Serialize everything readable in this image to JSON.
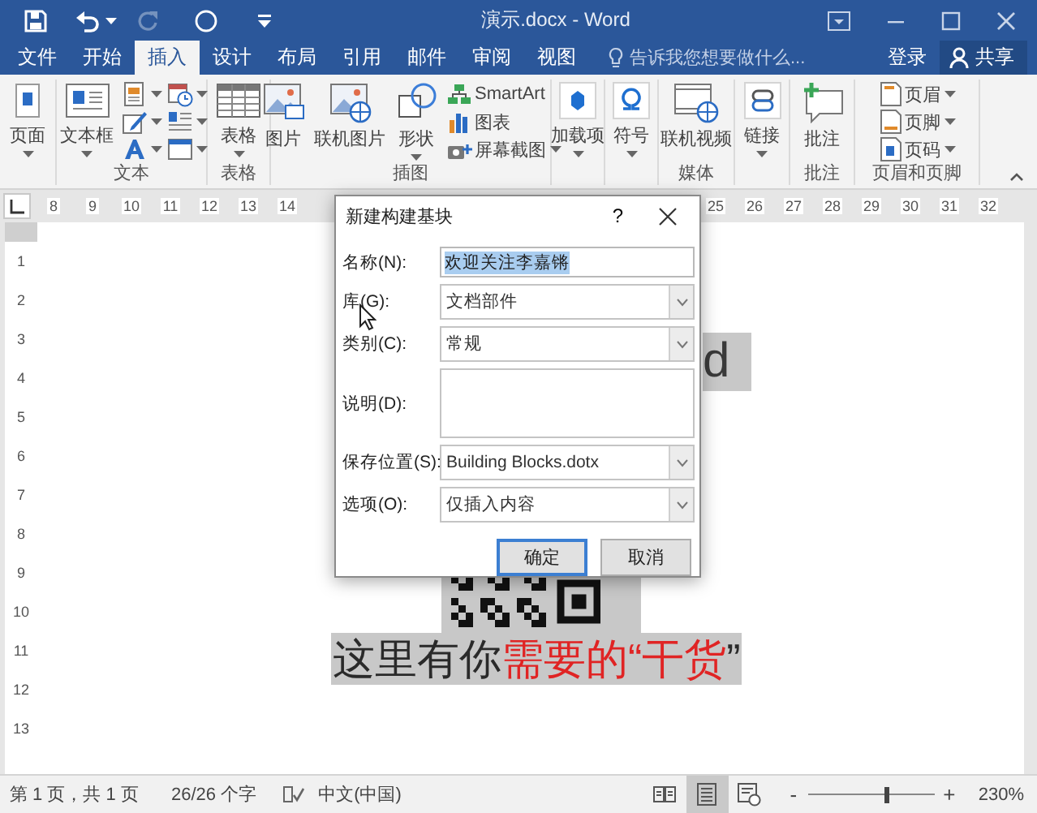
{
  "quick_access": [
    {
      "kind": "save",
      "disabled": false
    },
    {
      "kind": "undo",
      "disabled": false
    },
    {
      "kind": "redo",
      "disabled": true
    },
    {
      "kind": "touch",
      "disabled": false
    },
    {
      "kind": "customize",
      "disabled": false
    }
  ],
  "window": {
    "title": "演示.docx - Word"
  },
  "tabs": [
    {
      "label": "文件",
      "selected": false
    },
    {
      "label": "开始",
      "selected": false
    },
    {
      "label": "插入",
      "selected": true
    },
    {
      "label": "设计",
      "selected": false
    },
    {
      "label": "布局",
      "selected": false
    },
    {
      "label": "引用",
      "selected": false
    },
    {
      "label": "邮件",
      "selected": false
    },
    {
      "label": "审阅",
      "selected": false
    },
    {
      "label": "视图",
      "selected": false
    }
  ],
  "tell_me": {
    "placeholder": "告诉我您想要做什么..."
  },
  "sign_in": "登录",
  "share": "共享",
  "ribbon": {
    "groups": [
      {
        "items": [
          {
            "kind": "large",
            "label": "页面",
            "dropdown": true
          }
        ]
      },
      {
        "label": "文本",
        "items": [
          {
            "kind": "large",
            "label": "文本框",
            "dropdown": true
          },
          {
            "kind": "icon",
            "dropdown": true
          },
          {
            "kind": "icon",
            "dropdown": true
          },
          {
            "kind": "icon",
            "dropdown": true
          },
          {
            "kind": "icon",
            "dropdown": true
          },
          {
            "kind": "icon",
            "dropdown": true
          },
          {
            "kind": "icon",
            "dropdown": true
          }
        ]
      },
      {
        "label": "表格",
        "items": [
          {
            "kind": "large",
            "label": "表格",
            "dropdown": true
          }
        ]
      },
      {
        "label": "插图",
        "items": [
          {
            "kind": "large",
            "label": "图片",
            "dropdown": false
          },
          {
            "kind": "large",
            "label": "联机图片",
            "dropdown": false
          },
          {
            "kind": "large",
            "label": "形状",
            "dropdown": true
          },
          {
            "kind": "small",
            "label": "SmartArt",
            "dropdown": false
          },
          {
            "kind": "small",
            "label": "图表",
            "dropdown": false
          },
          {
            "kind": "small",
            "label": "屏幕截图",
            "dropdown": true
          }
        ]
      },
      {
        "items": [
          {
            "kind": "large",
            "label": "加载项",
            "dropdown": true
          }
        ]
      },
      {
        "items": [
          {
            "kind": "large",
            "label": "符号",
            "dropdown": true
          }
        ]
      },
      {
        "label": "媒体",
        "items": [
          {
            "kind": "large",
            "label": "联机视频",
            "dropdown": false
          }
        ]
      },
      {
        "items": [
          {
            "kind": "large",
            "label": "链接",
            "dropdown": true
          }
        ]
      },
      {
        "label": "批注",
        "items": [
          {
            "kind": "large",
            "label": "批注",
            "dropdown": false
          }
        ]
      },
      {
        "label": "页眉和页脚",
        "items": [
          {
            "kind": "small",
            "label": "页眉",
            "dropdown": true
          },
          {
            "kind": "small",
            "label": "页脚",
            "dropdown": true
          },
          {
            "kind": "small",
            "label": "页码",
            "dropdown": true
          }
        ]
      }
    ]
  },
  "ruler": {
    "left_labels": [
      "8",
      "9",
      "10",
      "11",
      "12",
      "13",
      "14"
    ],
    "right_labels": [
      "25",
      "26",
      "27",
      "28",
      "29",
      "30",
      "31",
      "32"
    ]
  },
  "vertical_ruler": {
    "labels": [
      "1",
      "2",
      "3",
      "4",
      "5",
      "6",
      "7",
      "8",
      "9",
      "10",
      "11",
      "12",
      "13"
    ]
  },
  "document": {
    "lines": [
      {
        "kind": "text",
        "segments": [
          {
            "text": "d",
            "color": "#3a3a3a"
          }
        ]
      },
      {
        "kind": "qr"
      },
      {
        "kind": "text",
        "segments": [
          {
            "text": "这里有你",
            "color": "#2a2a2a"
          },
          {
            "text": "需要的“干货",
            "color": "#e02424"
          },
          {
            "text": "”",
            "color": "#2a2a2a"
          }
        ]
      }
    ]
  },
  "dialog": {
    "title": "新建构建基块",
    "help": "?",
    "fields": [
      {
        "kind": "text",
        "label": "名称(N):",
        "value": "欢迎关注李嘉锵",
        "value_selected": true
      },
      {
        "kind": "combo",
        "label": "库(G):",
        "value": "文档部件"
      },
      {
        "kind": "combo",
        "label": "类别(C):",
        "value": "常规"
      },
      {
        "kind": "textarea",
        "label": "说明(D):"
      },
      {
        "kind": "combo",
        "label": "保存位置(S):",
        "value": "Building Blocks.dotx"
      },
      {
        "kind": "combo",
        "label": "选项(O):",
        "value": "仅插入内容"
      }
    ],
    "buttons": [
      {
        "label": "确定",
        "default": true
      },
      {
        "label": "取消",
        "default": false
      }
    ]
  },
  "status_bar": {
    "page": "第 1 页，共 1 页",
    "words": "26/26 个字",
    "language": "中文(中国)",
    "views": [
      {
        "kind": "read",
        "selected": false
      },
      {
        "kind": "print",
        "selected": true
      },
      {
        "kind": "web",
        "selected": false
      }
    ],
    "zoom_out": "-",
    "zoom": {
      "level": 0.62
    },
    "zoom_in": "+",
    "zoom_level": "230%"
  }
}
